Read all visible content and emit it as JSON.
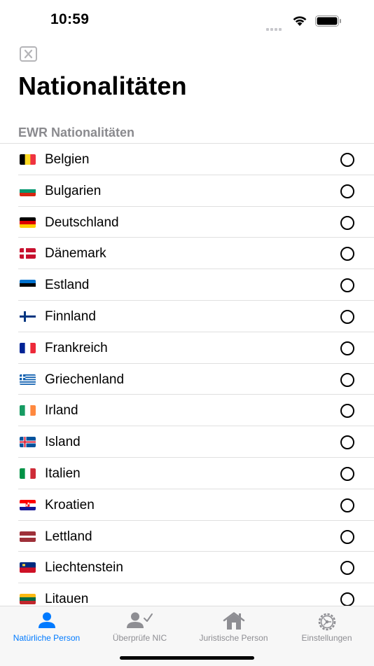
{
  "status_bar": {
    "time": "10:59"
  },
  "page": {
    "title": "Nationalitäten",
    "section_header": "EWR Nationalitäten"
  },
  "countries": [
    {
      "label": "Belgien",
      "flag": "flag-belgium-icon",
      "colors": [
        "#000000",
        "#FDDA24",
        "#EF3340"
      ],
      "layout": "vertical",
      "selected": false
    },
    {
      "label": "Bulgarien",
      "flag": "flag-bulgaria-icon",
      "colors": [
        "#FFFFFF",
        "#00966E",
        "#D62612"
      ],
      "layout": "horizontal",
      "selected": false
    },
    {
      "label": "Deutschland",
      "flag": "flag-germany-icon",
      "colors": [
        "#000000",
        "#DD0000",
        "#FFCE00"
      ],
      "layout": "horizontal",
      "selected": false
    },
    {
      "label": "Dänemark",
      "flag": "flag-denmark-icon",
      "colors": [
        "#C8102E",
        "#FFFFFF"
      ],
      "layout": "nordic",
      "selected": false
    },
    {
      "label": "Estland",
      "flag": "flag-estonia-icon",
      "colors": [
        "#0072CE",
        "#000000",
        "#FFFFFF"
      ],
      "layout": "horizontal",
      "selected": false
    },
    {
      "label": "Finnland",
      "flag": "flag-finland-icon",
      "colors": [
        "#FFFFFF",
        "#003580"
      ],
      "layout": "nordic",
      "selected": false
    },
    {
      "label": "Frankreich",
      "flag": "flag-france-icon",
      "colors": [
        "#002395",
        "#FFFFFF",
        "#ED2939"
      ],
      "layout": "vertical",
      "selected": false
    },
    {
      "label": "Griechenland",
      "flag": "flag-greece-icon",
      "colors": [
        "#0D5EAF",
        "#FFFFFF"
      ],
      "layout": "greece",
      "selected": false
    },
    {
      "label": "Irland",
      "flag": "flag-ireland-icon",
      "colors": [
        "#169B62",
        "#FFFFFF",
        "#FF883E"
      ],
      "layout": "vertical",
      "selected": false
    },
    {
      "label": "Island",
      "flag": "flag-iceland-icon",
      "colors": [
        "#02529C",
        "#DC1E35",
        "#FFFFFF"
      ],
      "layout": "nordic-border",
      "selected": false
    },
    {
      "label": "Italien",
      "flag": "flag-italy-icon",
      "colors": [
        "#009246",
        "#FFFFFF",
        "#CE2B37"
      ],
      "layout": "vertical",
      "selected": false
    },
    {
      "label": "Kroatien",
      "flag": "flag-croatia-icon",
      "colors": [
        "#FF0000",
        "#FFFFFF",
        "#171796"
      ],
      "layout": "horizontal-emblem",
      "selected": false
    },
    {
      "label": "Lettland",
      "flag": "flag-latvia-icon",
      "colors": [
        "#9E3039",
        "#FFFFFF",
        "#9E3039"
      ],
      "layout": "latvia",
      "selected": false
    },
    {
      "label": "Liechtenstein",
      "flag": "flag-liechtenstein-icon",
      "colors": [
        "#002B7F",
        "#CE1126"
      ],
      "layout": "horizontal2",
      "selected": false
    },
    {
      "label": "Litauen",
      "flag": "flag-lithuania-icon",
      "colors": [
        "#FDB913",
        "#006A44",
        "#C1272D"
      ],
      "layout": "horizontal",
      "selected": false
    }
  ],
  "tabs": [
    {
      "label": "Natürliche Person",
      "icon": "person-icon",
      "active": true
    },
    {
      "label": "Überprüfe NIC",
      "icon": "person-check-icon",
      "active": false
    },
    {
      "label": "Juristische Person",
      "icon": "house-icon",
      "active": false
    },
    {
      "label": "Einstellungen",
      "icon": "gear-icon",
      "active": false
    }
  ],
  "colors": {
    "accent": "#007AFF",
    "inactive_tab": "#8E8E93",
    "section_header": "#8A8A8E"
  }
}
